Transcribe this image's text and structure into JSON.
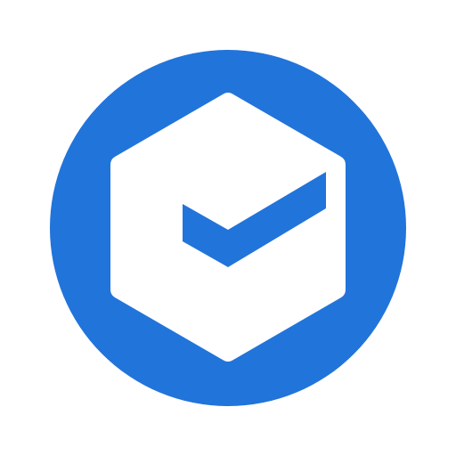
{
  "icon": {
    "name": "hexagon-checkmark-icon",
    "colors": {
      "circle": "#2174DA",
      "hexagon": "#FFFFFF",
      "checkmark": "#2174DA",
      "background": "#FFFFFF"
    }
  }
}
